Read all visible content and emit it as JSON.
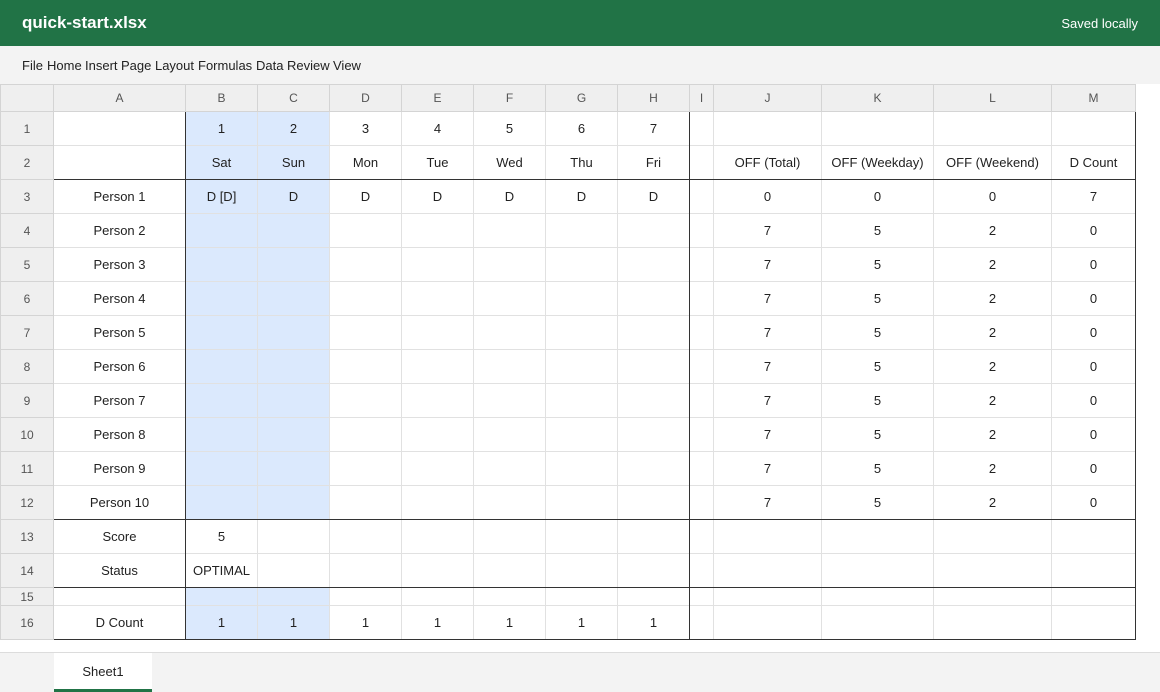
{
  "app": {
    "file_name": "quick-start.xlsx",
    "save_status": "Saved locally"
  },
  "menu": [
    "File",
    "Home",
    "Insert",
    "Page Layout",
    "Formulas",
    "Data",
    "Review",
    "View"
  ],
  "columns": [
    "A",
    "B",
    "C",
    "D",
    "E",
    "F",
    "G",
    "H",
    "I",
    "J",
    "K",
    "L",
    "M"
  ],
  "rows": [
    [
      "",
      "1",
      "2",
      "3",
      "4",
      "5",
      "6",
      "7",
      "",
      "",
      "",
      "",
      ""
    ],
    [
      "",
      "Sat",
      "Sun",
      "Mon",
      "Tue",
      "Wed",
      "Thu",
      "Fri",
      "",
      "OFF (Total)",
      "OFF (Weekday)",
      "OFF (Weekend)",
      "D Count"
    ],
    [
      "Person 1",
      "D [D]",
      "D",
      "D",
      "D",
      "D",
      "D",
      "D",
      "",
      "0",
      "0",
      "0",
      "7"
    ],
    [
      "Person 2",
      "",
      "",
      "",
      "",
      "",
      "",
      "",
      "",
      "7",
      "5",
      "2",
      "0"
    ],
    [
      "Person 3",
      "",
      "",
      "",
      "",
      "",
      "",
      "",
      "",
      "7",
      "5",
      "2",
      "0"
    ],
    [
      "Person 4",
      "",
      "",
      "",
      "",
      "",
      "",
      "",
      "",
      "7",
      "5",
      "2",
      "0"
    ],
    [
      "Person 5",
      "",
      "",
      "",
      "",
      "",
      "",
      "",
      "",
      "7",
      "5",
      "2",
      "0"
    ],
    [
      "Person 6",
      "",
      "",
      "",
      "",
      "",
      "",
      "",
      "",
      "7",
      "5",
      "2",
      "0"
    ],
    [
      "Person 7",
      "",
      "",
      "",
      "",
      "",
      "",
      "",
      "",
      "7",
      "5",
      "2",
      "0"
    ],
    [
      "Person 8",
      "",
      "",
      "",
      "",
      "",
      "",
      "",
      "",
      "7",
      "5",
      "2",
      "0"
    ],
    [
      "Person 9",
      "",
      "",
      "",
      "",
      "",
      "",
      "",
      "",
      "7",
      "5",
      "2",
      "0"
    ],
    [
      "Person 10",
      "",
      "",
      "",
      "",
      "",
      "",
      "",
      "",
      "7",
      "5",
      "2",
      "0"
    ],
    [
      "Score",
      "5",
      "",
      "",
      "",
      "",
      "",
      "",
      "",
      "",
      "",
      "",
      ""
    ],
    [
      "Status",
      "OPTIMAL",
      "",
      "",
      "",
      "",
      "",
      "",
      "",
      "",
      "",
      "",
      ""
    ],
    [
      "",
      "",
      "",
      "",
      "",
      "",
      "",
      "",
      "",
      "",
      "",
      "",
      ""
    ],
    [
      "D Count",
      "1",
      "1",
      "1",
      "1",
      "1",
      "1",
      "1",
      "",
      "",
      "",
      "",
      ""
    ]
  ],
  "sheets": [
    "Sheet1"
  ],
  "colors": {
    "brand": "#217346",
    "selection": "#dbe9fd"
  }
}
